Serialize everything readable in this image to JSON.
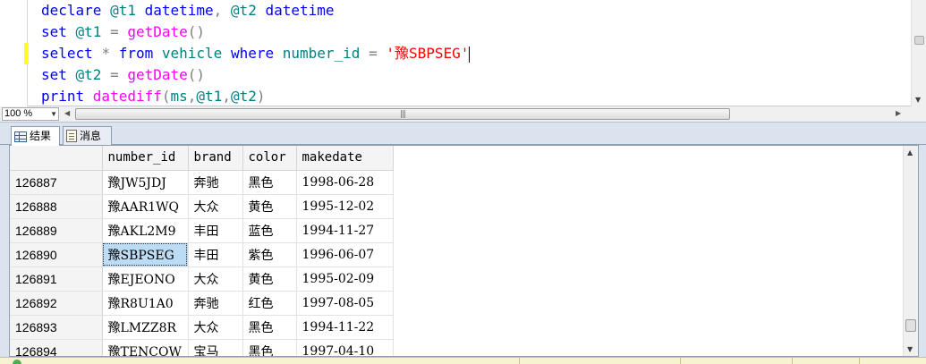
{
  "editor": {
    "lines": [
      [
        {
          "t": "declare ",
          "c": "kw"
        },
        {
          "t": "@t1 ",
          "c": "vr"
        },
        {
          "t": "datetime",
          "c": "kw"
        },
        {
          "t": ", ",
          "c": "op"
        },
        {
          "t": "@t2 ",
          "c": "vr"
        },
        {
          "t": "datetime",
          "c": "kw"
        }
      ],
      [
        {
          "t": "set ",
          "c": "kw"
        },
        {
          "t": "@t1 ",
          "c": "vr"
        },
        {
          "t": "= ",
          "c": "op"
        },
        {
          "t": "getDate",
          "c": "fn"
        },
        {
          "t": "()",
          "c": "op"
        }
      ],
      [
        {
          "t": "select ",
          "c": "kw"
        },
        {
          "t": "* ",
          "c": "op"
        },
        {
          "t": "from ",
          "c": "kw"
        },
        {
          "t": "vehicle ",
          "c": "vr"
        },
        {
          "t": "where ",
          "c": "kw"
        },
        {
          "t": "number_id ",
          "c": "vr"
        },
        {
          "t": "= ",
          "c": "op"
        },
        {
          "t": "'豫SBPSEG'",
          "c": "str"
        }
      ],
      [
        {
          "t": "set ",
          "c": "kw"
        },
        {
          "t": "@t2 ",
          "c": "vr"
        },
        {
          "t": "= ",
          "c": "op"
        },
        {
          "t": "getDate",
          "c": "fn"
        },
        {
          "t": "()",
          "c": "op"
        }
      ],
      [
        {
          "t": "print ",
          "c": "kw"
        },
        {
          "t": "datediff",
          "c": "fn"
        },
        {
          "t": "(",
          "c": "op"
        },
        {
          "t": "ms",
          "c": "vr"
        },
        {
          "t": ",",
          "c": "op"
        },
        {
          "t": "@t1",
          "c": "vr"
        },
        {
          "t": ",",
          "c": "op"
        },
        {
          "t": "@t2",
          "c": "vr"
        },
        {
          "t": ")",
          "c": "op"
        }
      ]
    ],
    "caret_line": 2
  },
  "zoom": {
    "value": "100 %"
  },
  "tabs": {
    "results": "结果",
    "messages": "消息"
  },
  "grid": {
    "columns": [
      "number_id",
      "brand",
      "color",
      "makedate"
    ],
    "rows": [
      [
        "126887",
        "豫JW5JDJ",
        "奔驰",
        "黑色",
        "1998-06-28"
      ],
      [
        "126888",
        "豫AAR1WQ",
        "大众",
        "黄色",
        "1995-12-02"
      ],
      [
        "126889",
        "豫AKL2M9",
        "丰田",
        "蓝色",
        "1994-11-27"
      ],
      [
        "126890",
        "豫SBPSEG",
        "丰田",
        "紫色",
        "1996-06-07"
      ],
      [
        "126891",
        "豫EJEONO",
        "大众",
        "黄色",
        "1995-02-09"
      ],
      [
        "126892",
        "豫R8U1A0",
        "奔驰",
        "红色",
        "1997-08-05"
      ],
      [
        "126893",
        "豫LMZZ8R",
        "大众",
        "黑色",
        "1994-11-22"
      ],
      [
        "126894",
        "豫TENCOW",
        "宝马",
        "黑色",
        "1997-04-10"
      ]
    ],
    "selected_row": 3,
    "selected_col": 1
  },
  "colors": {
    "keyword": "#0000ff",
    "function": "#ff00ff",
    "string": "#ff0000",
    "variable": "#008080",
    "selection": "#bcdcf6"
  }
}
